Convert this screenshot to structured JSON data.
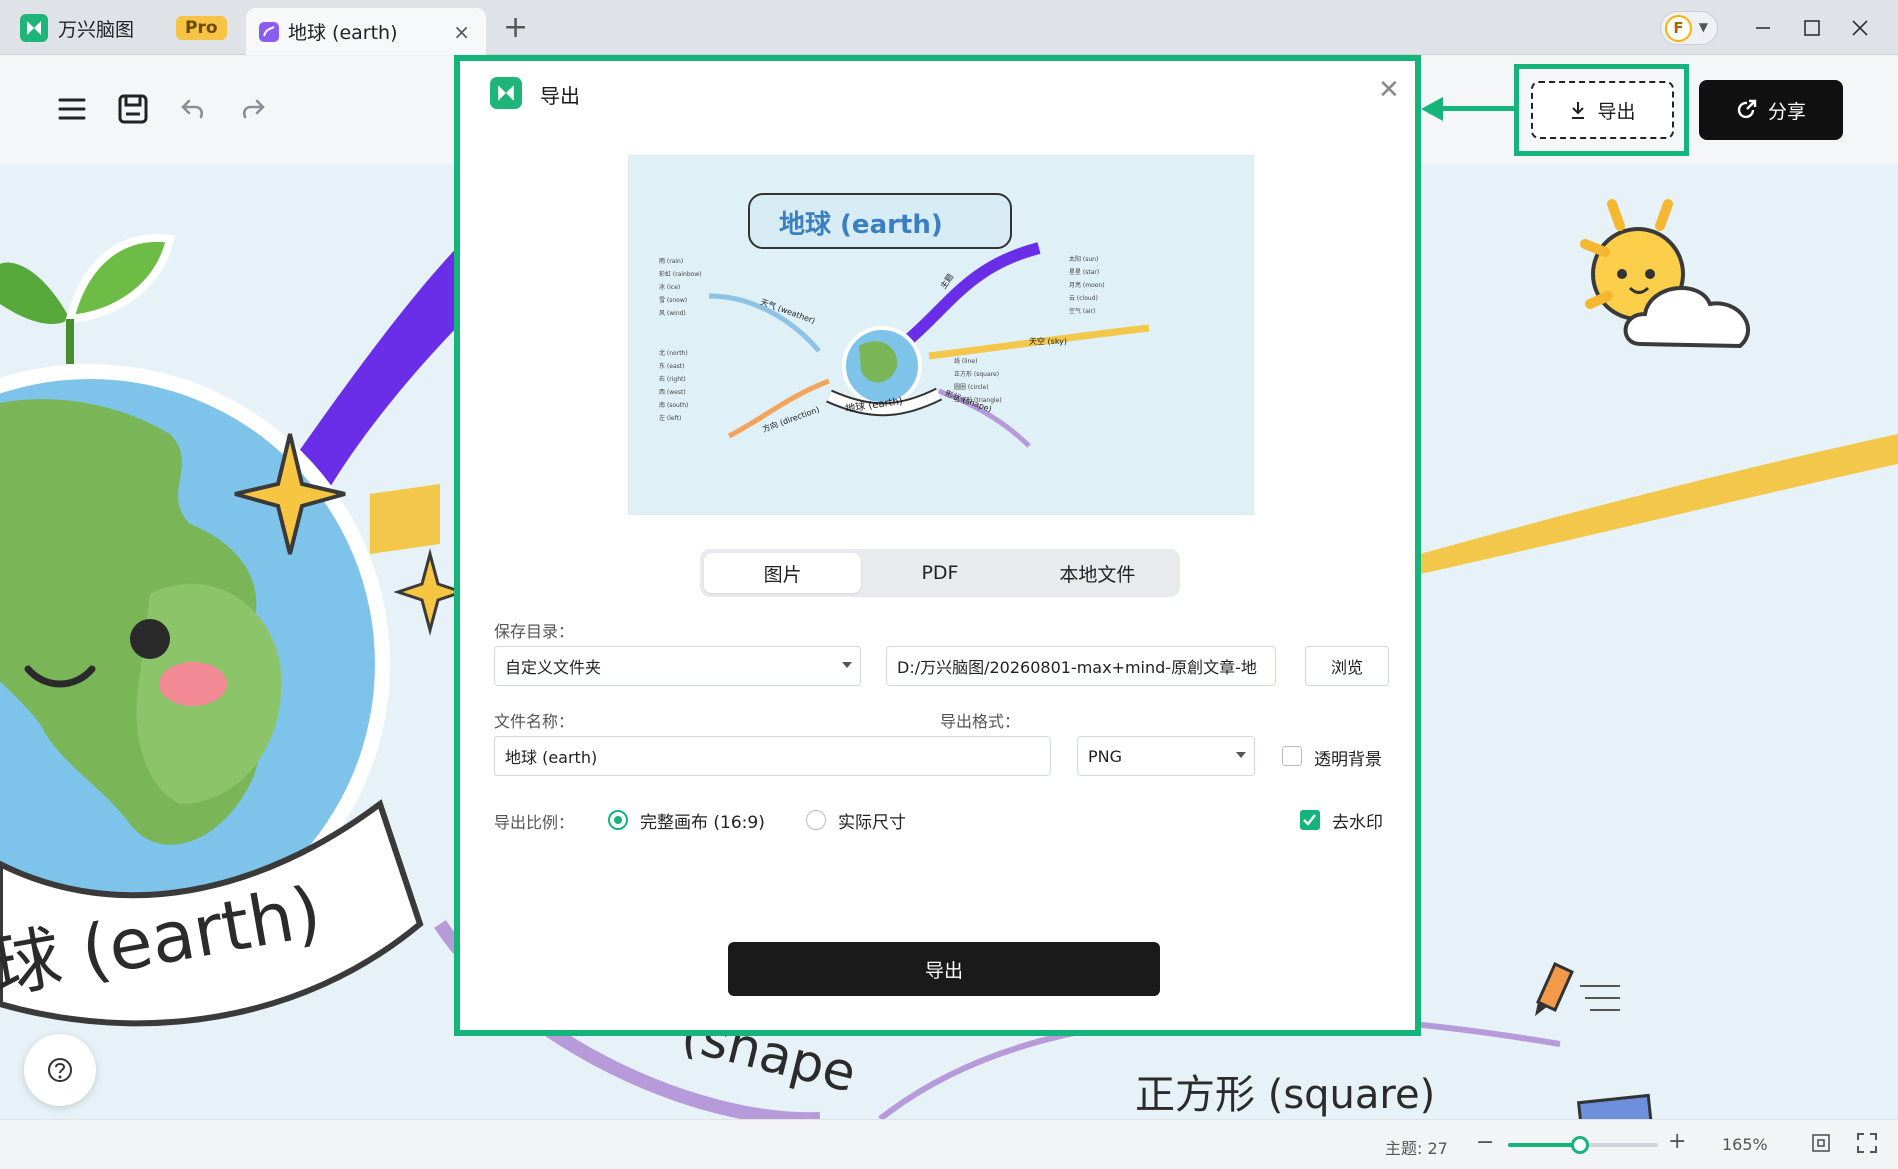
{
  "titlebar": {
    "home_tab": {
      "label": "万兴脑图",
      "badge": "Pro"
    },
    "doc_tab": {
      "label": "地球 (earth)",
      "close": "×"
    },
    "new_tab": "+",
    "user_initial": "F"
  },
  "toolbar": {
    "export_label": "导出",
    "share_label": "分享"
  },
  "canvas": {
    "labels": {
      "earth": "球 (earth)",
      "shape": "(shape",
      "square": "正方形 (square)"
    },
    "colors": {
      "purple_branch": "#6a2ee8",
      "yellow_branch": "#f2c74a",
      "lilac_branch": "#b79ad9",
      "accent": "#14b47a"
    }
  },
  "statusbar": {
    "topic_count": "主题: 27",
    "zoom": "165%",
    "zoom_level_percent": 48
  },
  "dialog": {
    "title": "导出",
    "tabs": [
      {
        "label": "图片",
        "active": true
      },
      {
        "label": "PDF",
        "active": false
      },
      {
        "label": "本地文件",
        "active": false
      }
    ],
    "save_dir_label": "保存目录：",
    "save_dir_value": "自定义文件夹",
    "save_path": "D:/万兴脑图/20260801-max+mind-原創文章-地",
    "browse_label": "浏览",
    "file_name_label": "文件名称：",
    "file_name_value": "地球 (earth)",
    "format_label": "导出格式：",
    "format_value": "PNG",
    "transparent_label": "透明背景",
    "transparent_checked": false,
    "ratio_label": "导出比例：",
    "ratio_options": [
      {
        "label": "完整画布 (16:9)",
        "checked": true
      },
      {
        "label": "实际尺寸",
        "checked": false
      }
    ],
    "watermark_label": "去水印",
    "watermark_checked": true,
    "export_button": "导出",
    "preview": {
      "title": "地球 (earth)",
      "center": "地球 (earth)",
      "branches": [
        {
          "label": "天气 (weather)",
          "items": [
            "雨 (rain)",
            "彩虹 (rainbow)",
            "冰 (ice)",
            "雪 (snow)",
            "风 (wind)"
          ]
        },
        {
          "label": "方向 (direction)",
          "items": [
            "北 (north)",
            "东 (east)",
            "右 (right)",
            "西 (west)",
            "南 (south)",
            "左 (left)"
          ]
        },
        {
          "label": "天空 (sky)",
          "items": [
            "太阳 (sun)",
            "星星 (star)",
            "月亮 (moon)",
            "云 (cloud)",
            "空气 (air)"
          ]
        },
        {
          "label": "形状 (shape)",
          "items": [
            "线 (line)",
            "正方形 (square)",
            "圆圈 (circle)",
            "三角形 (triangle)"
          ]
        },
        {
          "label": "主题",
          "items": []
        }
      ]
    }
  }
}
